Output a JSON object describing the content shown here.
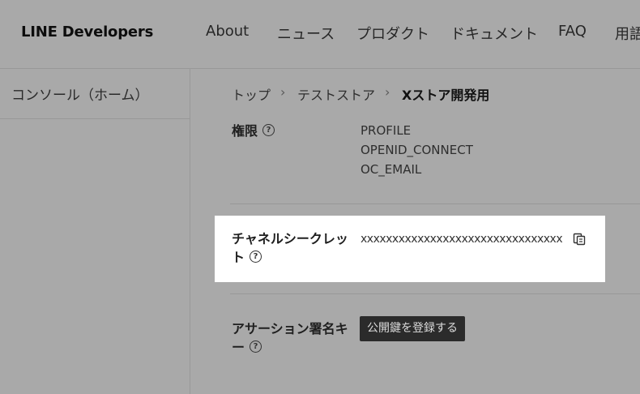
{
  "header": {
    "logo": "LINE Developers",
    "nav": [
      "About",
      "ニュース",
      "プロダクト",
      "ドキュメント",
      "FAQ",
      "用語"
    ]
  },
  "sidebar": {
    "title": "コンソール（ホーム）"
  },
  "breadcrumb": {
    "items": [
      "トップ",
      "テストストア",
      "Xストア開発用"
    ],
    "separator": "›"
  },
  "fields": {
    "permissions": {
      "label": "権限",
      "values": [
        "PROFILE",
        "OPENID_CONNECT",
        "OC_EMAIL"
      ]
    },
    "channel_secret": {
      "label_line1": "チャネルシークレッ",
      "label_line2": "ト",
      "value": "xxxxxxxxxxxxxxxxxxxxxxxxxxxxxxxx"
    },
    "assertion_key": {
      "label_line1": "アサーション署名キ",
      "label_line2": "ー",
      "button": "公開鍵を登録する"
    }
  },
  "icons": {
    "help": "?"
  }
}
